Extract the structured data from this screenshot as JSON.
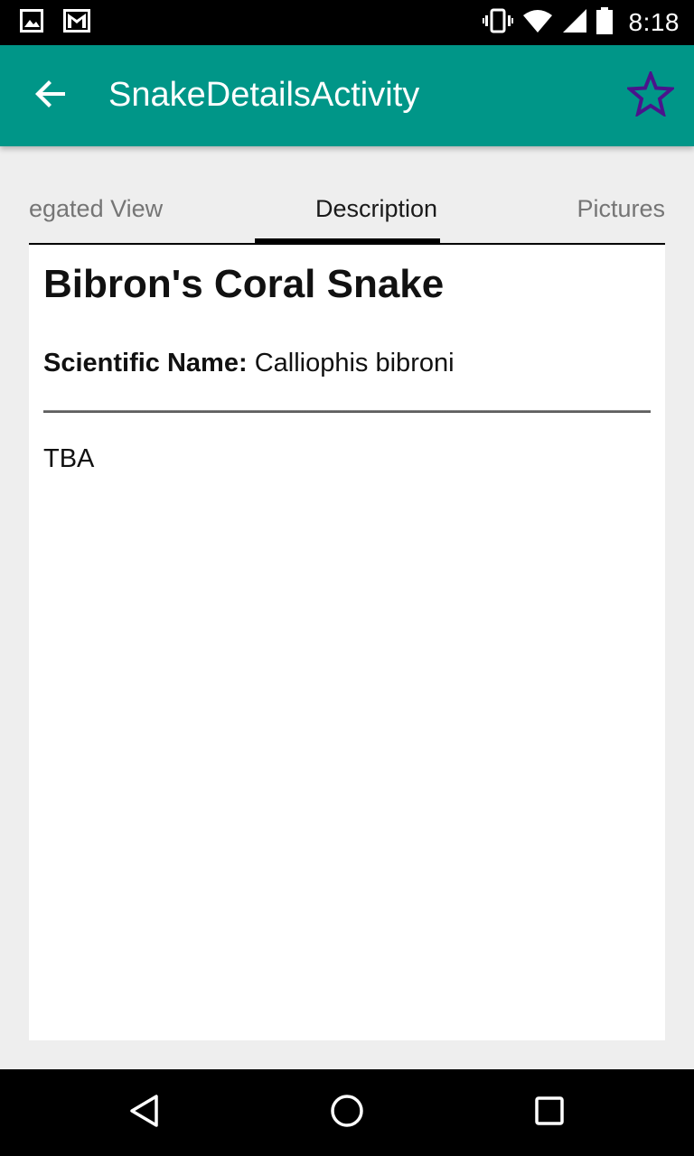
{
  "status_bar": {
    "time": "8:18",
    "left_icons": [
      "image-icon",
      "gmail-icon"
    ],
    "right_icons": [
      "vibrate-icon",
      "wifi-icon",
      "signal-icon",
      "battery-icon"
    ]
  },
  "app_bar": {
    "title": "SnakeDetailsActivity",
    "back_icon": "arrow-back-icon",
    "favorite_icon": "star-outline-icon",
    "background_color": "#009688",
    "star_color": "#4a148c"
  },
  "tabs": {
    "items": [
      {
        "label": "egated View"
      },
      {
        "label": "Description"
      },
      {
        "label": "Pictures"
      }
    ],
    "selected": "Description"
  },
  "content": {
    "snake_name": "Bibron's Coral Snake",
    "scientific_label": "Scientific Name:",
    "scientific_value": "Calliophis bibroni",
    "description": "TBA"
  },
  "nav_bar": {
    "icons": [
      "back-triangle-icon",
      "home-circle-icon",
      "recents-square-icon"
    ]
  }
}
